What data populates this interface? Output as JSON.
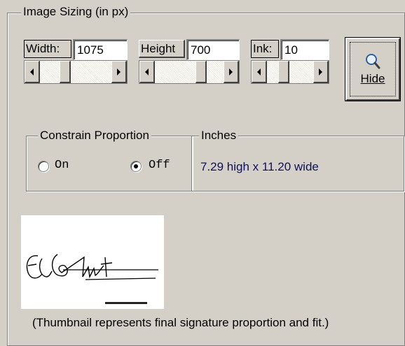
{
  "image_sizing": {
    "title": "Image Sizing (in px)",
    "width_label": "Width:",
    "width_value": "1075",
    "height_label": "Height",
    "height_value": "700",
    "ink_label": "Ink:",
    "ink_value": "10",
    "hide_button_label": "Hide"
  },
  "constrain": {
    "title": "Constrain Proportion",
    "on_label": "On",
    "off_label": "Off",
    "selected": "Off"
  },
  "inches": {
    "title": "Inches",
    "value": "7.29 high x 11.20 wide"
  },
  "thumbnail": {
    "caption": "(Thumbnail represents final signature proportion and fit.)"
  },
  "colors": {
    "dialog_bg": "#d4d0c8",
    "inches_text": "#101060"
  }
}
